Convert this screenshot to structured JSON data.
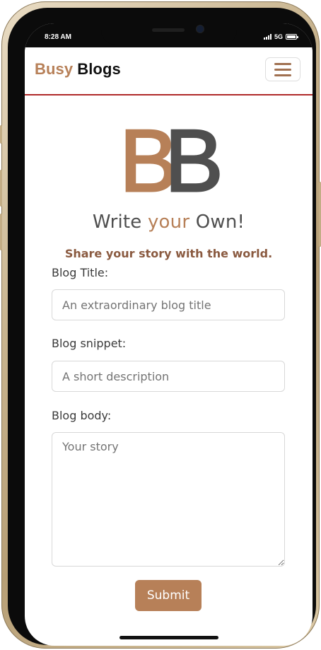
{
  "status_bar": {
    "time": "8:28 AM",
    "network": "5G"
  },
  "navbar": {
    "brand_part1": "Busy",
    "brand_part2": "Blogs",
    "brand_color": "#b78058",
    "menu_icon": "hamburger-menu-icon"
  },
  "logo": {
    "letter1": "B",
    "letter2": "B",
    "letter1_color": "#b78058",
    "letter2_color": "#4f4f4f"
  },
  "heading": {
    "part1": "Write",
    "part2": "your",
    "part3": "Own!",
    "subtitle": "Share your story with the world."
  },
  "form": {
    "title_label": "Blog Title:",
    "title_placeholder": "An extraordinary blog title",
    "snippet_label": "Blog snippet:",
    "snippet_placeholder": "A short description",
    "body_label": "Blog body:",
    "body_placeholder": "Your story",
    "submit_label": "Submit"
  },
  "colors": {
    "accent": "#b78058",
    "navbar_border": "#b02a2a",
    "text_dark": "#4f4f4f"
  }
}
